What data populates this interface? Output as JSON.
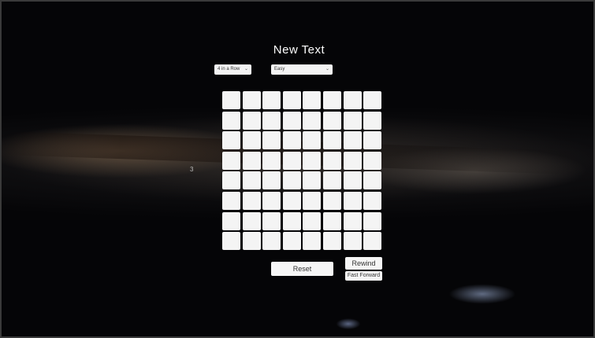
{
  "title": "New Text",
  "mode_dropdown": {
    "selected": "4 in a Row",
    "chevron_icon": "chevron-down-icon"
  },
  "difficulty_dropdown": {
    "selected": "Easy",
    "chevron_icon": "chevron-down-icon"
  },
  "board": {
    "columns": 8,
    "rows": 8,
    "cell_color": "#f4f4f4"
  },
  "side_label": "3",
  "buttons": {
    "reset": "Reset",
    "rewind": "Rewind",
    "fast_forward": "Fast Forward"
  }
}
